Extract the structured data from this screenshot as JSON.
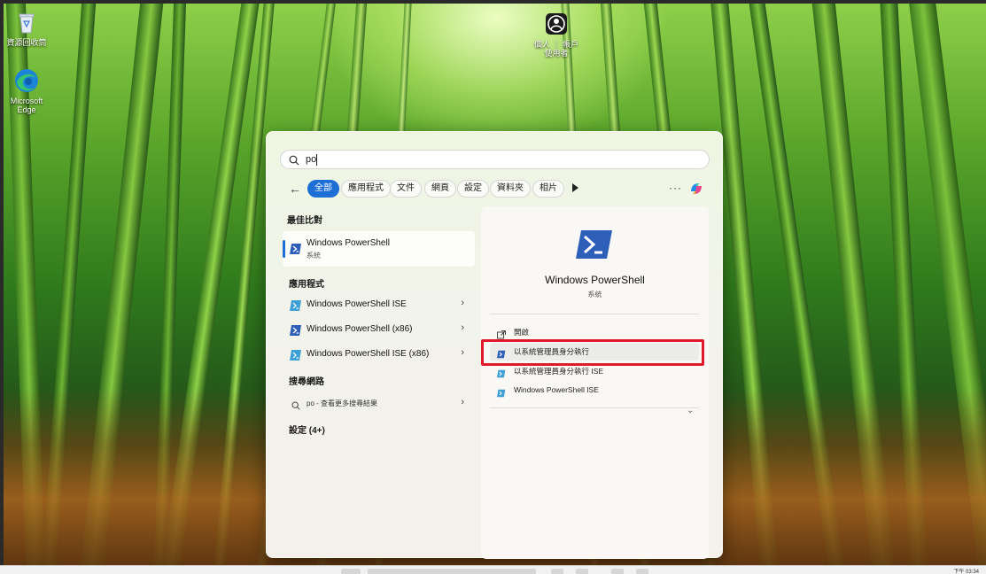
{
  "desktop": {
    "icons": [
      {
        "label": "資源回收筒",
        "icon": "recycle-bin-icon"
      },
      {
        "label": "Microsoft Edge",
        "icon": "edge-icon"
      },
      {
        "label": "個人 ｜ 帳戶 使用者",
        "icon": "user-account-icon"
      }
    ]
  },
  "search": {
    "query": "po"
  },
  "filters": {
    "items": [
      "全部",
      "應用程式",
      "文件",
      "網頁",
      "設定",
      "資料夾",
      "相片"
    ],
    "active_index": 0,
    "more": "···"
  },
  "results": {
    "best_match_heading": "最佳比對",
    "best_match": {
      "title": "Windows PowerShell",
      "subtitle": "系統",
      "icon": "powershell-icon"
    },
    "apps_heading": "應用程式",
    "apps": [
      {
        "label": "Windows PowerShell ISE",
        "icon": "powershell-ise-icon"
      },
      {
        "label": "Windows PowerShell (x86)",
        "icon": "powershell-icon"
      },
      {
        "label": "Windows PowerShell ISE (x86)",
        "icon": "powershell-ise-icon"
      }
    ],
    "web_heading": "搜尋網路",
    "web": {
      "label": "po - 查看更多搜尋結果"
    },
    "settings_heading": "設定 (4+)"
  },
  "details": {
    "title": "Windows PowerShell",
    "subtitle": "系統",
    "actions": [
      {
        "label": "開啟",
        "icon": "open-icon"
      },
      {
        "label": "以系統管理員身分執行",
        "icon": "powershell-icon"
      },
      {
        "label": "以系統管理員身分執行 ISE",
        "icon": "powershell-ise-icon"
      },
      {
        "label": "Windows PowerShell ISE",
        "icon": "powershell-ise-icon"
      }
    ]
  },
  "taskbar": {
    "time": "下午 03:34"
  },
  "colors": {
    "accent": "#1d6fd6",
    "powershell_blue": "#2d5eb8",
    "highlight_red": "#e0192c"
  }
}
